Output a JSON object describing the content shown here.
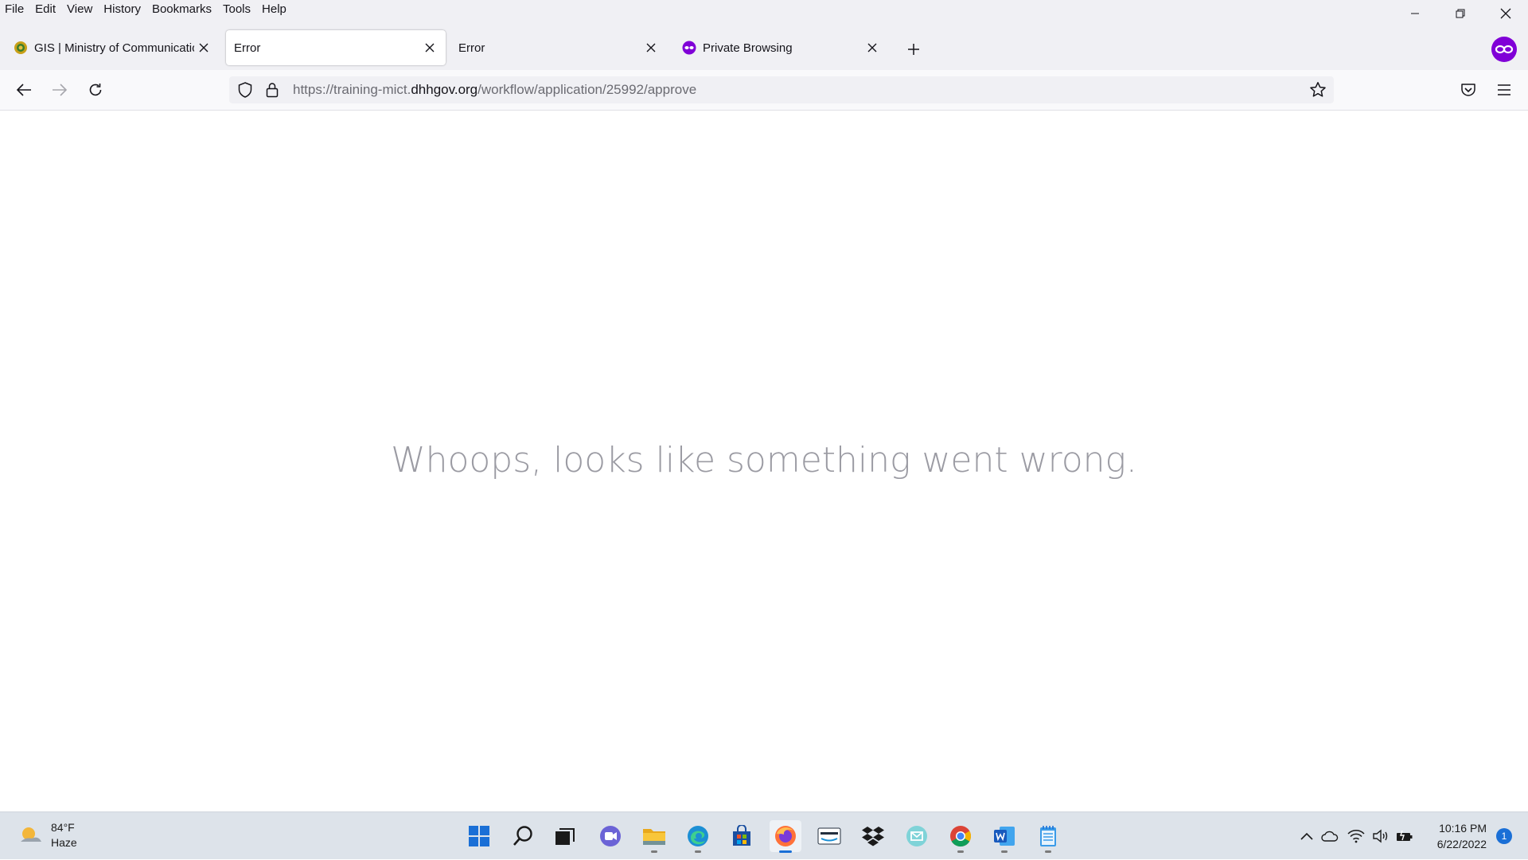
{
  "menubar": {
    "items": [
      "File",
      "Edit",
      "View",
      "History",
      "Bookmarks",
      "Tools",
      "Help"
    ]
  },
  "tabs": [
    {
      "title": "GIS | Ministry of Communications",
      "active": false
    },
    {
      "title": "Error",
      "active": true
    },
    {
      "title": "Error",
      "active": false
    },
    {
      "title": "Private Browsing",
      "active": false
    }
  ],
  "urlbar": {
    "prefix": "https://training-mict.",
    "domain": "dhhgov.org",
    "path": "/workflow/application/25992/approve"
  },
  "page": {
    "message": "Whoops, looks like something went wrong."
  },
  "taskbar": {
    "weather_temp": "84°F",
    "weather_desc": "Haze",
    "time": "10:16 PM",
    "date": "6/22/2022",
    "notification_count": "1"
  },
  "colors": {
    "private_accent": "#8000d7",
    "windows_blue": "#1a6fd6"
  }
}
